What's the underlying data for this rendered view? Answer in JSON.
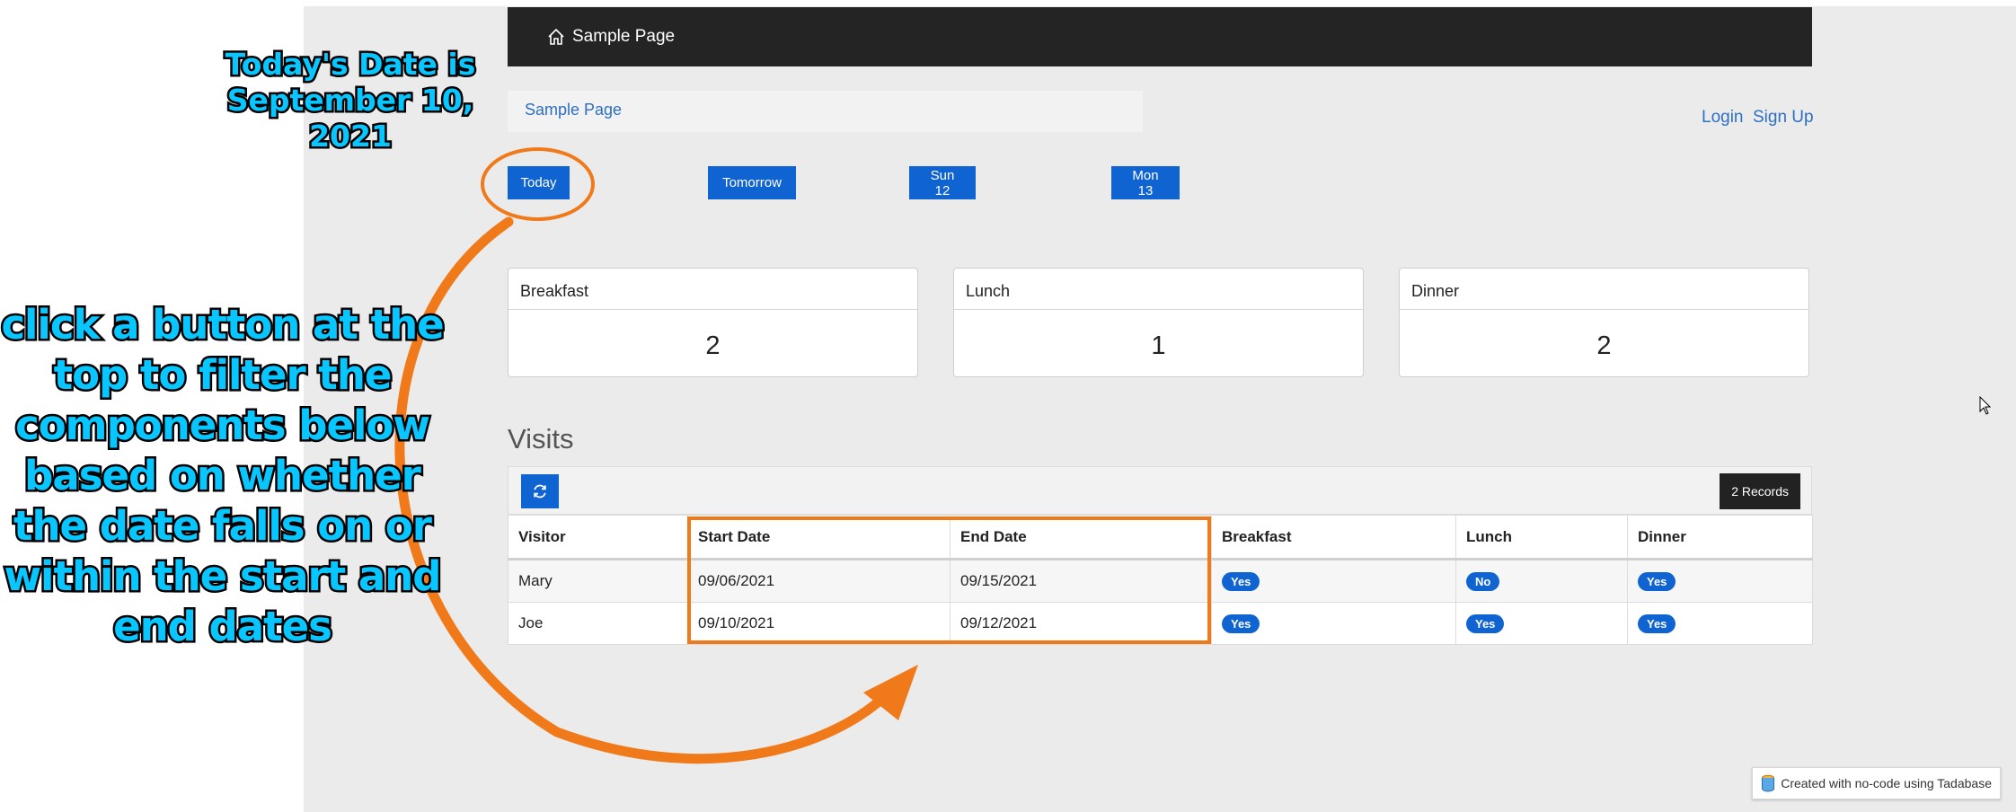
{
  "annotations": {
    "date_note": "Today's Date is\nSeptember 10, 2021",
    "instruction": "click a button at the top to filter the components below based on whether the date falls on or within the start and end dates"
  },
  "navbar": {
    "home_icon": "home-icon",
    "title": "Sample Page"
  },
  "breadcrumb": "Sample Page",
  "auth": {
    "login": "Login",
    "signup": "Sign Up"
  },
  "day_buttons": [
    "Today",
    "Tomorrow",
    "Sun 12",
    "Mon 13"
  ],
  "meals": [
    {
      "label": "Breakfast",
      "count": "2"
    },
    {
      "label": "Lunch",
      "count": "1"
    },
    {
      "label": "Dinner",
      "count": "2"
    }
  ],
  "visits": {
    "title": "Visits",
    "refresh_icon": "refresh-icon",
    "records_label": "2 Records",
    "columns": [
      "Visitor",
      "Start Date",
      "End Date",
      "Breakfast",
      "Lunch",
      "Dinner"
    ],
    "rows": [
      [
        "Mary",
        "09/06/2021",
        "09/15/2021",
        "Yes",
        "No",
        "Yes"
      ],
      [
        "Joe",
        "09/10/2021",
        "09/12/2021",
        "Yes",
        "Yes",
        "Yes"
      ]
    ]
  },
  "footer_badge": {
    "icon": "database-icon",
    "text": "Created with no-code using Tadabase"
  },
  "colors": {
    "accent": "#1064d2",
    "annotation": "#f07a1a",
    "callout_text": "#08c6ff",
    "navbar": "#242424"
  }
}
